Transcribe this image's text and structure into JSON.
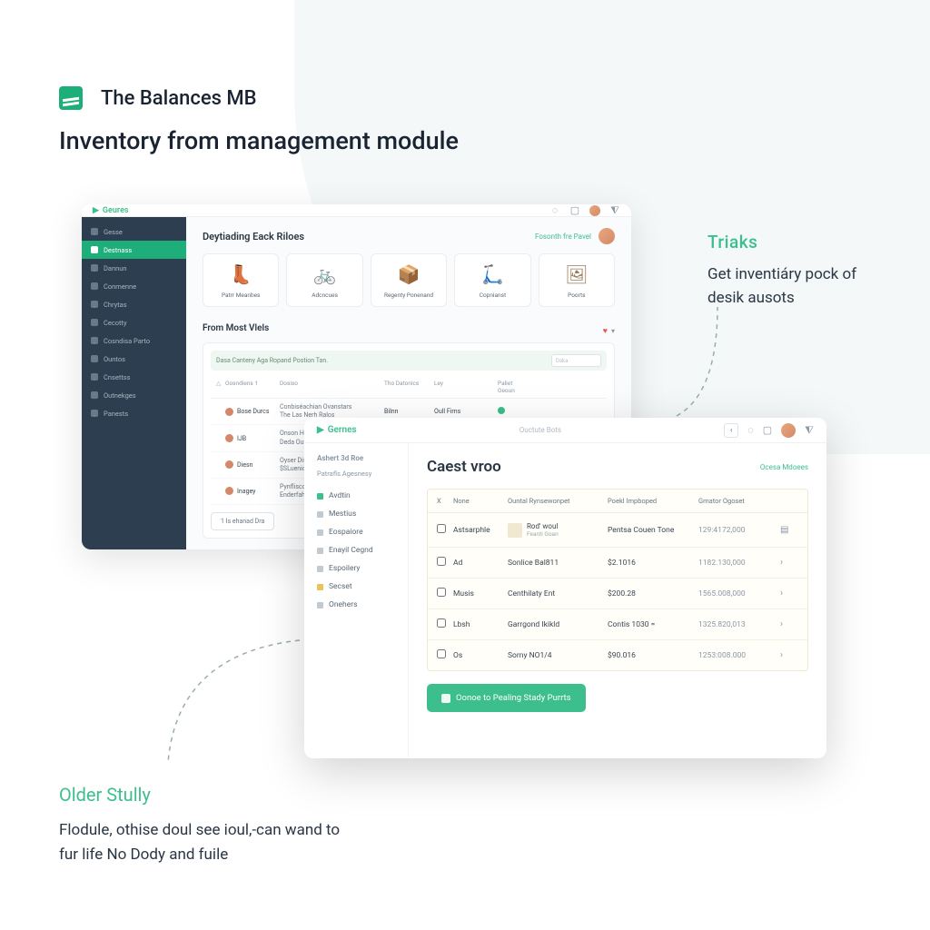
{
  "brand": {
    "title": "The Balances MB"
  },
  "subtitle": "Inventory from management  module",
  "callouts": {
    "right": {
      "title": "Triaks",
      "body": "Get inventiáry pock of desik ausots"
    },
    "bottom": {
      "title": "Older Stully",
      "body": "Flodule, othise doul see ioul,-can wand to fur life No Dody and fuile"
    }
  },
  "win1": {
    "logo": "Geures",
    "header": {
      "title": "Deytiading Eack Riloes",
      "action": "Fosonth fre Pavel"
    },
    "sidebar": [
      {
        "label": "Gesse",
        "active": false
      },
      {
        "label": "Destnass",
        "active": true
      },
      {
        "label": "Dannun",
        "active": false
      },
      {
        "label": "Conmenne",
        "active": false
      },
      {
        "label": "Chrytas",
        "active": false
      },
      {
        "label": "Cecotty",
        "active": false
      },
      {
        "label": "Cosndisa Parto",
        "active": false
      },
      {
        "label": "Ountos",
        "active": false
      },
      {
        "label": "Cnsettss",
        "active": false
      },
      {
        "label": "Outnekges",
        "active": false
      },
      {
        "label": "Panests",
        "active": false
      }
    ],
    "products": [
      {
        "label": "Patrr Meanbes",
        "icon": "👢",
        "cls": "p-boot"
      },
      {
        "label": "Adcncues",
        "icon": "🚲",
        "cls": "p-bike"
      },
      {
        "label": "Regenty Ponenand",
        "icon": "📦",
        "cls": "p-box"
      },
      {
        "label": "Copnianst",
        "icon": "🛴",
        "cls": "p-scooter"
      },
      {
        "label": "Poorts",
        "icon": "🖼",
        "cls": "p-frame"
      }
    ],
    "section": {
      "title": "From Most Vlels",
      "banner": "Dasa Canteny Aga Ropand Postion Tan.",
      "search": "Dska",
      "cols": [
        "△",
        "Oosndiens 1",
        "Dosiso",
        "Tho Datonics",
        "Ley",
        "Paliet Oeoun"
      ],
      "rows": [
        {
          "name": "Bose Durcs",
          "desc": "Conbiséachian Ovanstars\nThe Las Nerh Ralos",
          "c4": "Bilnn",
          "c5": "Oull Firns",
          "dot": true
        },
        {
          "name": "IJB",
          "desc": "Onson Heuato\nDeda Outvehan",
          "c4": "",
          "c5": "",
          "dot": false
        },
        {
          "name": "Diesn",
          "desc": "Oyser Disal Fors\n$SLuenionsent",
          "c4": "",
          "c5": "",
          "dot": false
        },
        {
          "name": "Inagey",
          "desc": "Pynfliscorion\nEnderfahards",
          "c4": "",
          "c5": "",
          "dot": false
        }
      ],
      "footer_btn": "1 Is ehanad Dra"
    }
  },
  "win2": {
    "logo": "Gernes",
    "crumb": "Ouctute Bots",
    "sidebar": {
      "title": "Ashert 3d Roe",
      "subtitle": "Patrafls.Agesnesy",
      "items": [
        {
          "label": "Avdtin",
          "cls": "green"
        },
        {
          "label": "Mestius",
          "cls": ""
        },
        {
          "label": "Eospaiore",
          "cls": ""
        },
        {
          "label": "Enayil Cegnd",
          "cls": ""
        },
        {
          "label": "Espoilery",
          "cls": ""
        },
        {
          "label": "Secset",
          "cls": "yellow"
        },
        {
          "label": "Onehers",
          "cls": ""
        }
      ]
    },
    "header": {
      "title": "Caest vroo",
      "action": "Ocesa Mdoees"
    },
    "table": {
      "cols": [
        "X",
        "None",
        "Ountal Rynsewonpet",
        "Poekl Impboped",
        "Gmator Ogoset",
        ""
      ],
      "rows": [
        {
          "name": "Astsarphle",
          "desc": "Rod' woul",
          "sub": "Feanti Goan",
          "c4": "Pentsa Couen Tone",
          "c5": "129:4172,000",
          "action": "del"
        },
        {
          "name": "Ad",
          "desc": "Sonlice Bal811",
          "c4": "$2.1016",
          "c5": "1182.130,000",
          "action": "chev"
        },
        {
          "name": "Musis",
          "desc": "Centhilaty Ent",
          "c4": "$200.28",
          "c5": "1565.008,000",
          "action": "chev"
        },
        {
          "name": "Lbsh",
          "desc": "Garrgond Ikikld",
          "c4": "Contis 1030 =",
          "c5": "1325.820,013",
          "action": "chev"
        },
        {
          "name": "Os",
          "desc": "Sorny NO1/4",
          "c4": "$90.016",
          "c5": "1253:008.000",
          "action": "chev"
        }
      ]
    },
    "primary_btn": "Oonoe to Pealing Stady Purrts"
  }
}
